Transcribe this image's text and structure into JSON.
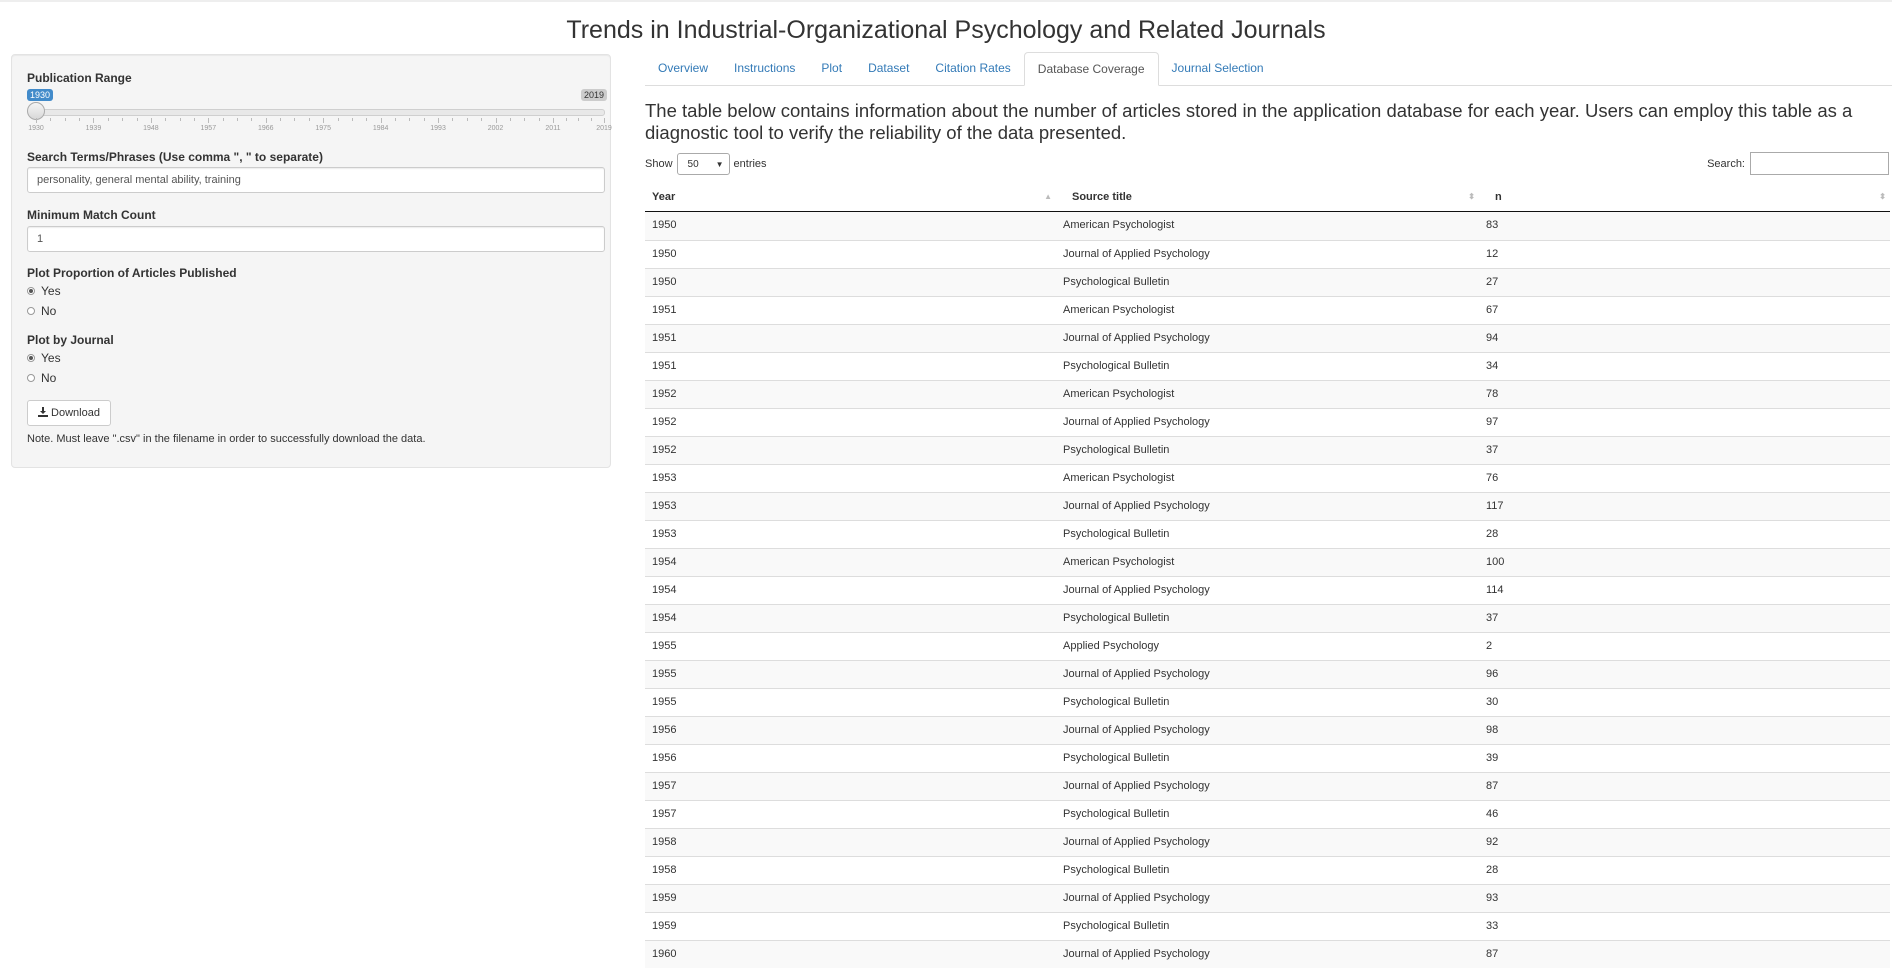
{
  "app": {
    "title": "Trends in Industrial-Organizational Psychology and Related Journals"
  },
  "sidebar": {
    "publication_range": {
      "label": "Publication Range",
      "min_value": "1930",
      "max_value": "2019",
      "selected_from": "1930",
      "selected_to": "2019",
      "tick_labels": [
        "1930",
        "1939",
        "1948",
        "1957",
        "1966",
        "1975",
        "1984",
        "1993",
        "2002",
        "2011",
        "2019"
      ]
    },
    "search_terms": {
      "label": "Search Terms/Phrases (Use comma \", \" to separate)",
      "value": "personality, general mental ability, training"
    },
    "min_match": {
      "label": "Minimum Match Count",
      "value": "1"
    },
    "plot_proportion": {
      "label": "Plot Proportion of Articles Published",
      "options": [
        "Yes",
        "No"
      ],
      "selected": "Yes"
    },
    "plot_by_journal": {
      "label": "Plot by Journal",
      "options": [
        "Yes",
        "No"
      ],
      "selected": "Yes"
    },
    "download": {
      "label": "Download",
      "icon": "download-icon"
    },
    "note": "Note. Must leave \".csv\" in the filename in order to successfully download the data."
  },
  "tabs": [
    {
      "label": "Overview",
      "active": false
    },
    {
      "label": "Instructions",
      "active": false
    },
    {
      "label": "Plot",
      "active": false
    },
    {
      "label": "Dataset",
      "active": false
    },
    {
      "label": "Citation Rates",
      "active": false
    },
    {
      "label": "Database Coverage",
      "active": true
    },
    {
      "label": "Journal Selection",
      "active": false
    }
  ],
  "main": {
    "description": "The table below contains information about the number of articles stored in the application database for each year. Users can employ this table as a diagnostic tool to verify the reliability of the data presented.",
    "length_control": {
      "show_label": "Show",
      "value": "50",
      "entries_label": "entries"
    },
    "search": {
      "label": "Search:",
      "value": ""
    },
    "table": {
      "columns": [
        "Year",
        "Source title",
        "n"
      ],
      "rows": [
        [
          "1950",
          "American Psychologist",
          "83"
        ],
        [
          "1950",
          "Journal of Applied Psychology",
          "12"
        ],
        [
          "1950",
          "Psychological Bulletin",
          "27"
        ],
        [
          "1951",
          "American Psychologist",
          "67"
        ],
        [
          "1951",
          "Journal of Applied Psychology",
          "94"
        ],
        [
          "1951",
          "Psychological Bulletin",
          "34"
        ],
        [
          "1952",
          "American Psychologist",
          "78"
        ],
        [
          "1952",
          "Journal of Applied Psychology",
          "97"
        ],
        [
          "1952",
          "Psychological Bulletin",
          "37"
        ],
        [
          "1953",
          "American Psychologist",
          "76"
        ],
        [
          "1953",
          "Journal of Applied Psychology",
          "117"
        ],
        [
          "1953",
          "Psychological Bulletin",
          "28"
        ],
        [
          "1954",
          "American Psychologist",
          "100"
        ],
        [
          "1954",
          "Journal of Applied Psychology",
          "114"
        ],
        [
          "1954",
          "Psychological Bulletin",
          "37"
        ],
        [
          "1955",
          "Applied Psychology",
          "2"
        ],
        [
          "1955",
          "Journal of Applied Psychology",
          "96"
        ],
        [
          "1955",
          "Psychological Bulletin",
          "30"
        ],
        [
          "1956",
          "Journal of Applied Psychology",
          "98"
        ],
        [
          "1956",
          "Psychological Bulletin",
          "39"
        ],
        [
          "1957",
          "Journal of Applied Psychology",
          "87"
        ],
        [
          "1957",
          "Psychological Bulletin",
          "46"
        ],
        [
          "1958",
          "Journal of Applied Psychology",
          "92"
        ],
        [
          "1958",
          "Psychological Bulletin",
          "28"
        ],
        [
          "1959",
          "Journal of Applied Psychology",
          "93"
        ],
        [
          "1959",
          "Psychological Bulletin",
          "33"
        ],
        [
          "1960",
          "Journal of Applied Psychology",
          "87"
        ]
      ]
    }
  }
}
